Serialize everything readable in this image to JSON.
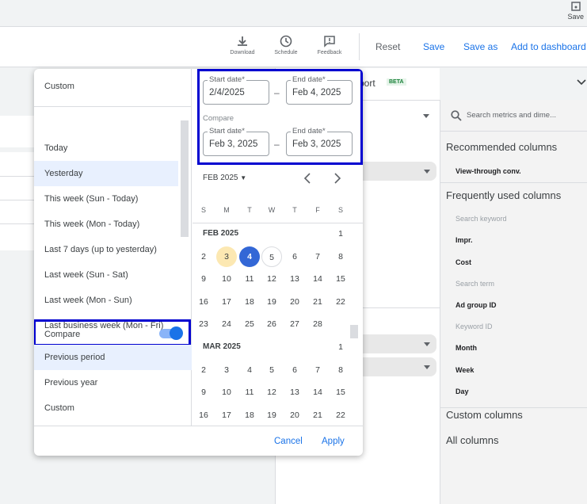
{
  "topbar": {
    "save_label": "Save"
  },
  "toolbar": {
    "download": "Download",
    "schedule": "Schedule",
    "feedback": "Feedback",
    "reset": "Reset",
    "save": "Save",
    "save_as": "Save as",
    "add_to_dashboard": "Add to dashboard"
  },
  "report": {
    "title_fragment": "port",
    "beta_badge": "BETA"
  },
  "columns_panel": {
    "search_placeholder": "Search metrics and dime...",
    "recommended_title": "Recommended columns",
    "recommended": [
      "View-through conv."
    ],
    "frequent_title": "Frequently used columns",
    "frequent": [
      {
        "label": "Search keyword",
        "disabled": true
      },
      {
        "label": "Impr.",
        "disabled": false
      },
      {
        "label": "Cost",
        "disabled": false
      },
      {
        "label": "Search term",
        "disabled": true
      },
      {
        "label": "Ad group ID",
        "disabled": false
      },
      {
        "label": "Keyword ID",
        "disabled": true
      },
      {
        "label": "Month",
        "disabled": false
      },
      {
        "label": "Week",
        "disabled": false
      },
      {
        "label": "Day",
        "disabled": false
      }
    ],
    "custom_title": "Custom columns",
    "all_title": "All columns"
  },
  "date_picker": {
    "custom_label": "Custom",
    "presets": [
      "Today",
      "Yesterday",
      "This week (Sun - Today)",
      "This week (Mon - Today)",
      "Last 7 days (up to yesterday)",
      "Last week (Sun - Sat)",
      "Last week (Mon - Sun)",
      "Last business week (Mon - Fri)"
    ],
    "selected_preset": "Yesterday",
    "compare_label": "Compare",
    "compare_enabled": true,
    "compare_options": [
      "Previous period",
      "Previous year",
      "Custom"
    ],
    "selected_compare": "Previous period",
    "start_label": "Start date*",
    "end_label": "End date*",
    "start_value": "2/4/2025",
    "end_value": "Feb 4, 2025",
    "compare_section_label": "Compare",
    "compare_start_value": "Feb 3, 2025",
    "compare_end_value": "Feb 3, 2025",
    "dash": "–",
    "month_selector": "FEB 2025",
    "weekdays": [
      "S",
      "M",
      "T",
      "W",
      "T",
      "F",
      "S"
    ],
    "months": [
      {
        "label": "FEB 2025",
        "first_weekday": 6,
        "days": 28
      },
      {
        "label": "MAR 2025",
        "first_weekday": 6,
        "days": 31
      }
    ],
    "selected_day": 4,
    "compare_day": 3,
    "today_day": 5,
    "cancel": "Cancel",
    "apply": "Apply",
    "colors": {
      "selected": "#3367d6",
      "compare": "#fce8b2",
      "highlight": "#0000d0",
      "accent": "#1a73e8"
    }
  }
}
